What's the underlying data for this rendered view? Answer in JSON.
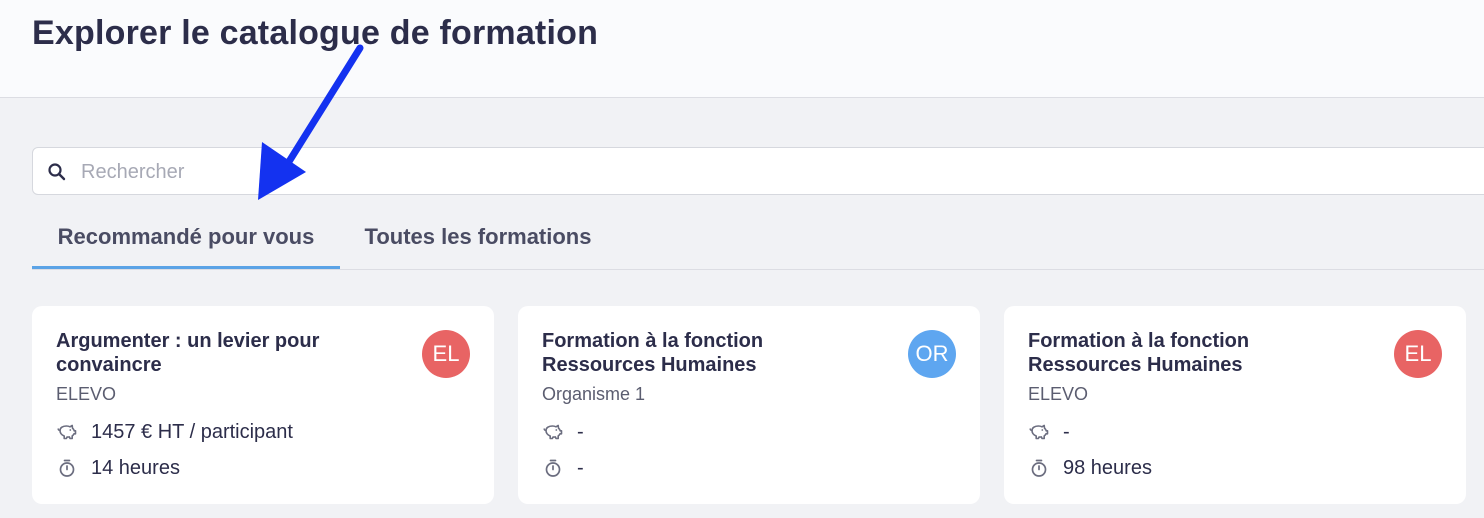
{
  "page": {
    "title": "Explorer le catalogue de formation"
  },
  "search": {
    "placeholder": "Rechercher",
    "icon": "search-icon"
  },
  "tabs": [
    {
      "label": "Recommandé pour vous",
      "active": true
    },
    {
      "label": "Toutes les formations",
      "active": false
    }
  ],
  "cards": [
    {
      "title": "Argumenter : un levier pour convaincre",
      "organization": "ELEVO",
      "avatar": {
        "initials": "EL",
        "color": "#e86464"
      },
      "price": "1457 € HT / participant",
      "duration": "14 heures"
    },
    {
      "title": "Formation à la fonction Ressources Humaines",
      "organization": "Organisme 1",
      "avatar": {
        "initials": "OR",
        "color": "#5ea6f0"
      },
      "price": "-",
      "duration": "-"
    },
    {
      "title": "Formation à la fonction Ressources Humaines",
      "organization": "ELEVO",
      "avatar": {
        "initials": "EL",
        "color": "#e86464"
      },
      "price": "-",
      "duration": "98 heures"
    }
  ],
  "colors": {
    "accent": "#5ba3e6",
    "annotation_arrow": "#1432f0"
  },
  "icons": {
    "price": "piggy-bank-icon",
    "duration": "stopwatch-icon"
  }
}
